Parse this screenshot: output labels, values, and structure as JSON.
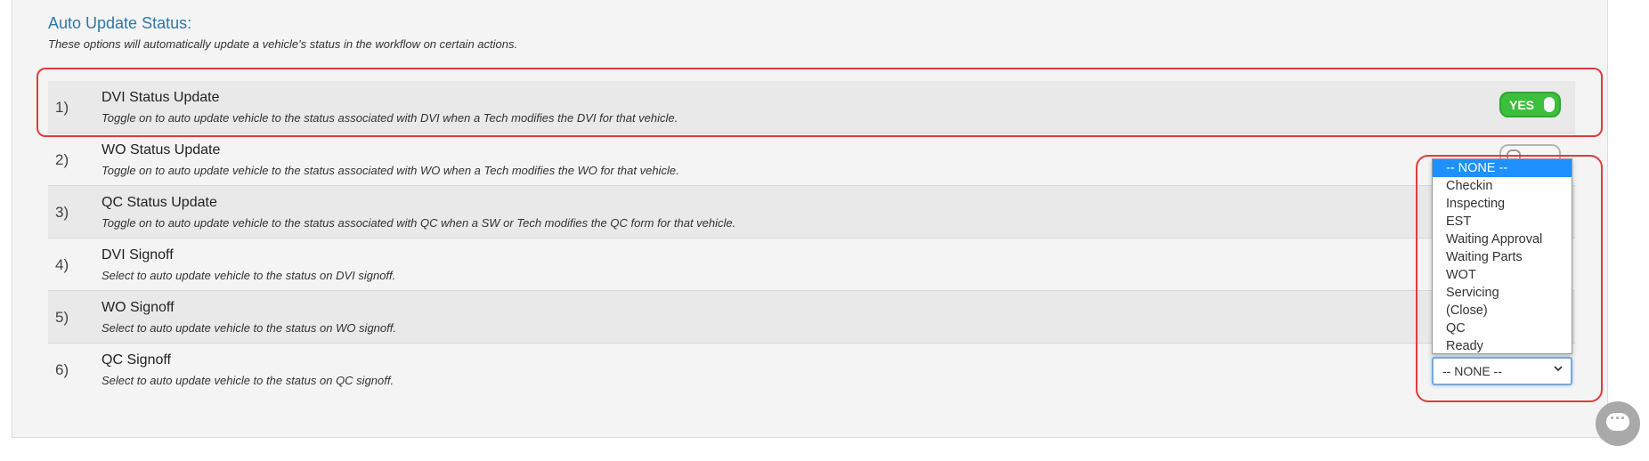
{
  "header": {
    "title": "Auto Update Status:",
    "subtitle": "These options will automatically update a vehicle's status in the workflow on certain actions."
  },
  "rows": [
    {
      "num": "1)",
      "label": "DVI Status Update",
      "desc": "Toggle on to auto update vehicle to the status associated with DVI when a Tech modifies the DVI for that vehicle.",
      "control": "toggle",
      "toggle_text": "YES",
      "toggle_state": "on"
    },
    {
      "num": "2)",
      "label": "WO Status Update",
      "desc": "Toggle on to auto update vehicle to the status associated with WO when a Tech modifies the WO for that vehicle.",
      "control": "toggle",
      "toggle_state": "off"
    },
    {
      "num": "3)",
      "label": "QC Status Update",
      "desc": "Toggle on to auto update vehicle to the status associated with QC when a SW or Tech modifies the QC form for that vehicle.",
      "control": "toggle"
    },
    {
      "num": "4)",
      "label": "DVI Signoff",
      "desc": "Select to auto update vehicle to the status on DVI signoff.",
      "control": "select"
    },
    {
      "num": "5)",
      "label": "WO Signoff",
      "desc": "Select to auto update vehicle to the status on WO signoff.",
      "control": "select"
    },
    {
      "num": "6)",
      "label": "QC Signoff",
      "desc": "Select to auto update vehicle to the status on QC signoff.",
      "control": "select"
    }
  ],
  "select": {
    "value": "-- NONE --",
    "options": [
      "-- NONE --",
      "Checkin",
      "Inspecting",
      "EST",
      "Waiting Approval",
      "Waiting Parts",
      "WOT",
      "Servicing",
      "(Close)",
      "QC",
      "Ready"
    ],
    "selected_index": 0
  },
  "colors": {
    "title": "#2d77a8",
    "toggle_on": "#3cbf3c",
    "highlight": "#e03b3b",
    "option_selected": "#1e90ff"
  },
  "icons": {
    "chat": "chat-icon",
    "chevron": "chevron-down-icon"
  }
}
